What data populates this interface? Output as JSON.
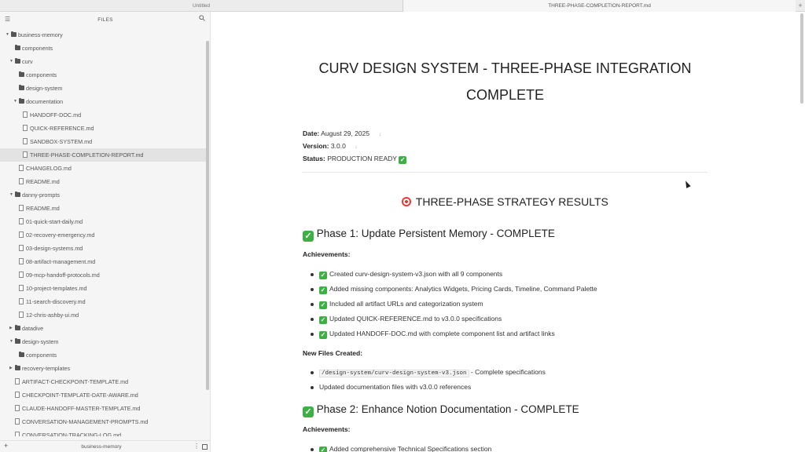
{
  "tabs": [
    {
      "label": "Untitled"
    },
    {
      "label": "THREE-PHASE-COMPLETION-REPORT.md"
    }
  ],
  "sidebar": {
    "title": "FILES",
    "footer_name": "business-memory",
    "tree": [
      {
        "label": "business-memory",
        "kind": "folder",
        "depth": 0,
        "expanded": true
      },
      {
        "label": "components",
        "kind": "folder",
        "depth": 1
      },
      {
        "label": "curv",
        "kind": "folder",
        "depth": 1,
        "expanded": true
      },
      {
        "label": "components",
        "kind": "folder",
        "depth": 2
      },
      {
        "label": "design-system",
        "kind": "folder",
        "depth": 2
      },
      {
        "label": "documentation",
        "kind": "folder",
        "depth": 2,
        "expanded": true
      },
      {
        "label": "HANDOFF-DOC.md",
        "kind": "file",
        "depth": 3
      },
      {
        "label": "QUICK-REFERENCE.md",
        "kind": "file",
        "depth": 3
      },
      {
        "label": "SANDBOX-SYSTEM.md",
        "kind": "file",
        "depth": 3
      },
      {
        "label": "THREE-PHASE-COMPLETION-REPORT.md",
        "kind": "file",
        "depth": 3,
        "active": true
      },
      {
        "label": "CHANGELOG.md",
        "kind": "file",
        "depth": 2
      },
      {
        "label": "README.md",
        "kind": "file",
        "depth": 2
      },
      {
        "label": "danny-prompts",
        "kind": "folder",
        "depth": 1,
        "expanded": true
      },
      {
        "label": "README.md",
        "kind": "file",
        "depth": 2
      },
      {
        "label": "01-quick-start-daily.md",
        "kind": "file",
        "depth": 2
      },
      {
        "label": "02-recovery-emergency.md",
        "kind": "file",
        "depth": 2
      },
      {
        "label": "03-design-systems.md",
        "kind": "file",
        "depth": 2
      },
      {
        "label": "08-artifact-management.md",
        "kind": "file",
        "depth": 2
      },
      {
        "label": "09-mcp-handoff-protocols.md",
        "kind": "file",
        "depth": 2
      },
      {
        "label": "10-project-templates.md",
        "kind": "file",
        "depth": 2
      },
      {
        "label": "11-search-discovery.md",
        "kind": "file",
        "depth": 2
      },
      {
        "label": "12-chris-ashby-ui.md",
        "kind": "file",
        "depth": 2
      },
      {
        "label": "datadive",
        "kind": "folder",
        "depth": 1,
        "expanded": false
      },
      {
        "label": "design-system",
        "kind": "folder",
        "depth": 1,
        "expanded": true
      },
      {
        "label": "components",
        "kind": "folder",
        "depth": 2
      },
      {
        "label": "recovery-templates",
        "kind": "folder",
        "depth": 1,
        "expanded": false
      },
      {
        "label": "ARTIFACT-CHECKPOINT-TEMPLATE.md",
        "kind": "file",
        "depth": 1
      },
      {
        "label": "CHECKPOINT-TEMPLATE-DATE-AWARE.md",
        "kind": "file",
        "depth": 1
      },
      {
        "label": "CLAUDE-HANDOFF-MASTER-TEMPLATE.md",
        "kind": "file",
        "depth": 1
      },
      {
        "label": "CONVERSATION-MANAGEMENT-PROMPTS.md",
        "kind": "file",
        "depth": 1
      },
      {
        "label": "CONVERSATION-TRACKING-LOG.md",
        "kind": "file",
        "depth": 1
      }
    ]
  },
  "doc": {
    "title_line1": "CURV DESIGN SYSTEM - THREE-PHASE INTEGRATION",
    "title_line2": "COMPLETE",
    "meta": [
      {
        "key": "Date:",
        "value": "August 29, 2025",
        "arrow": "↓"
      },
      {
        "key": "Version:",
        "value": "3.0.0",
        "arrow": "↓"
      },
      {
        "key": "Status:",
        "value": "PRODUCTION READY",
        "check": true
      }
    ],
    "strategy_heading": "THREE-PHASE STRATEGY RESULTS",
    "phase1": {
      "heading": "Phase 1: Update Persistent Memory - COMPLETE",
      "achievements_label": "Achievements:",
      "achievements": [
        "Created curv-design-system-v3.json with all 9 components",
        "Added missing components: Analytics Widgets, Pricing Cards, Timeline, Command Palette",
        "Included all artifact URLs and categorization system",
        "Updated QUICK-REFERENCE.md to v3.0.0 specifications",
        "Updated HANDOFF-DOC.md with complete component list and artifact links"
      ],
      "new_files_label": "New Files Created:",
      "new_files_code": "/design-system/curv-design-system-v3.json",
      "new_files_code_suffix": " - Complete specifications",
      "new_files_other": "Updated documentation files with v3.0.0 references"
    },
    "phase2": {
      "heading": "Phase 2: Enhance Notion Documentation - COMPLETE",
      "achievements_label": "Achievements:",
      "achievements": [
        "Added comprehensive Technical Specifications section"
      ]
    }
  }
}
